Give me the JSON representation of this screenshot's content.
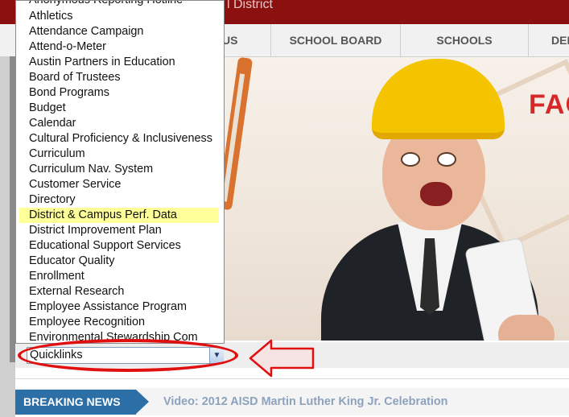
{
  "header": {
    "title": "l District"
  },
  "nav": {
    "items": [
      {
        "label": "US"
      },
      {
        "label": "SCHOOL BOARD"
      },
      {
        "label": "SCHOOLS"
      },
      {
        "label": "DEP"
      }
    ]
  },
  "hero": {
    "banner_text": "FAC"
  },
  "dropdown": {
    "items": [
      "Anonymous Reporting Hotline",
      "Athletics",
      "Attendance Campaign",
      "Attend-o-Meter",
      "Austin Partners in Education",
      "Board of Trustees",
      "Bond Programs",
      "Budget",
      "Calendar",
      "Cultural Proficiency & Inclusiveness",
      "Curriculum",
      "Curriculum Nav. System",
      "Customer Service",
      "Directory",
      "District & Campus Perf. Data",
      "District Improvement Plan",
      "Educational Support Services",
      "Educator Quality",
      "Enrollment",
      "External Research",
      "Employee Assistance Program",
      "Employee Recognition",
      "Environmental Stewardship Com"
    ],
    "highlighted_item": "District & Campus Perf. Data",
    "highlight_color": "#ffff99"
  },
  "quicklinks": {
    "value": "Quicklinks"
  },
  "breaking_news": {
    "label": "BREAKING NEWS",
    "headline": "Video: 2012 AISD Martin Luther King Jr. Celebration"
  },
  "colors": {
    "header": "#8b1111",
    "breaking_news": "#2c6ea6",
    "annotation": "#e01010"
  }
}
